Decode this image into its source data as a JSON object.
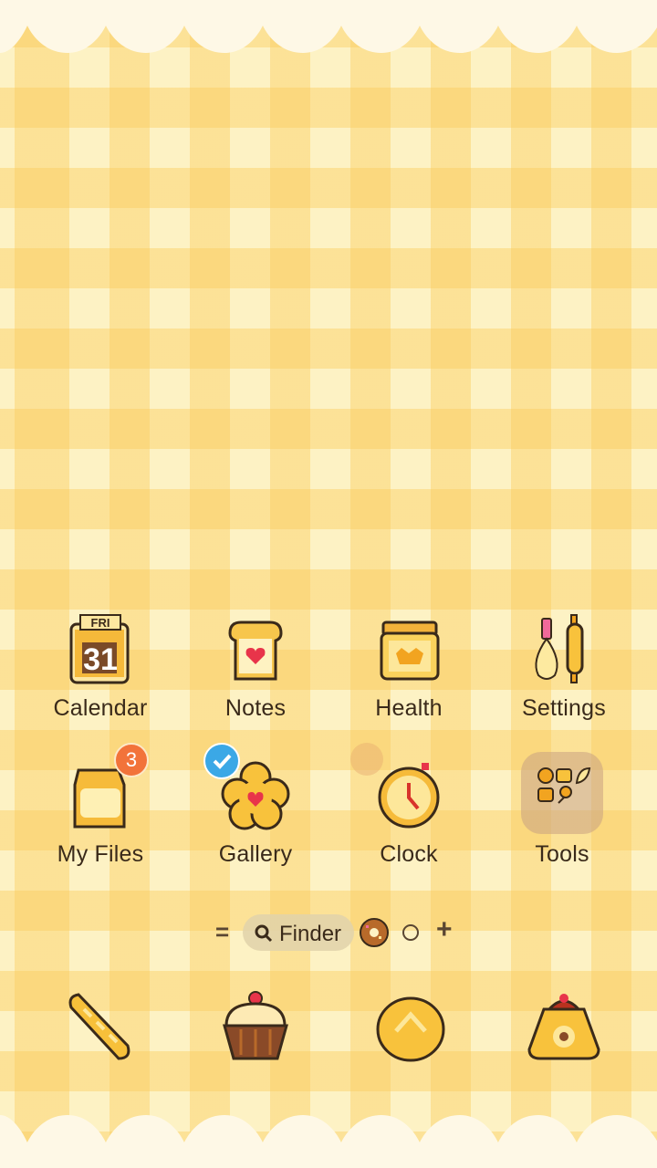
{
  "home": {
    "apps": [
      {
        "label": "Calendar",
        "icon": "calendar-icon",
        "day": "FRI",
        "date": "31"
      },
      {
        "label": "Notes",
        "icon": "toast-notes-icon"
      },
      {
        "label": "Health",
        "icon": "honey-jar-health-icon"
      },
      {
        "label": "Settings",
        "icon": "whisk-rolling-pin-settings-icon"
      },
      {
        "label": "My Files",
        "icon": "flour-bag-files-icon",
        "badge": "3"
      },
      {
        "label": "Gallery",
        "icon": "flower-cookie-gallery-icon"
      },
      {
        "label": "Clock",
        "icon": "cookie-clock-icon"
      },
      {
        "label": "Tools",
        "icon": "folder-tools-icon"
      }
    ]
  },
  "finder": {
    "menu_icon": "=",
    "label": "Finder",
    "add_icon": "+"
  },
  "dock": {
    "items": [
      {
        "icon": "baguette-phone-icon"
      },
      {
        "icon": "cupcake-messages-icon"
      },
      {
        "icon": "bun-browser-icon"
      },
      {
        "icon": "pudding-camera-icon"
      }
    ]
  },
  "colors": {
    "gingham_light": "#fdf2c4",
    "gingham_dark": "#facd5f",
    "badge": "#f2733a",
    "check": "#3ba8e6",
    "text": "#3a2a1a"
  }
}
